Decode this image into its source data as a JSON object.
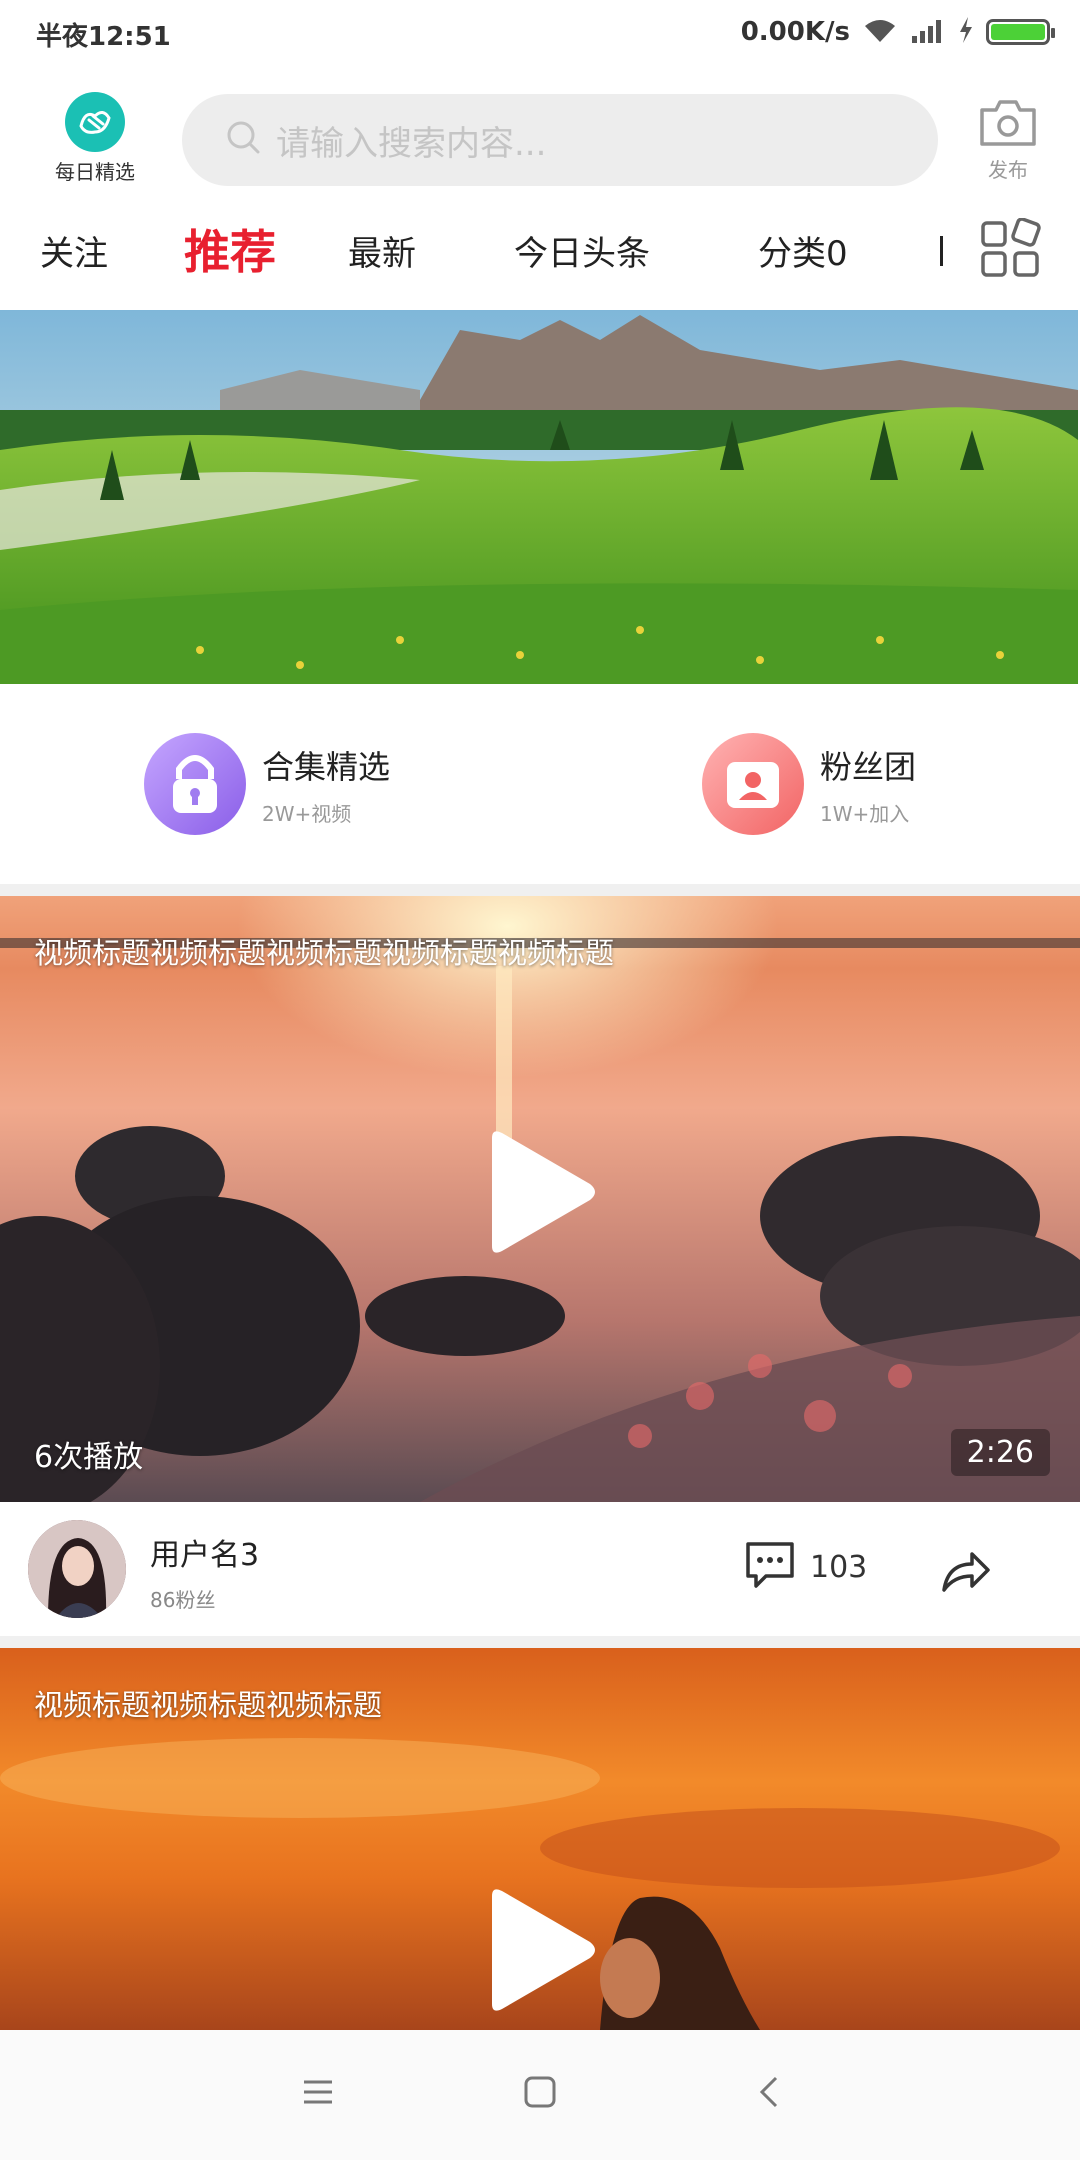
{
  "status_bar": {
    "time": "半夜12:51",
    "speed": "0.00K/s",
    "battery_color": "#4cd137"
  },
  "header": {
    "daily_label": "每日精选",
    "search_placeholder": "请输入搜索内容...",
    "publish_label": "发布"
  },
  "tabs": [
    {
      "label": "关注"
    },
    {
      "label": "推荐",
      "active": true
    },
    {
      "label": "最新"
    },
    {
      "label": "今日头条"
    },
    {
      "label": "分类0"
    }
  ],
  "quick_entries": [
    {
      "title": "合集精选",
      "subtitle": "2W+视频",
      "icon": "lock-icon"
    },
    {
      "title": "粉丝团",
      "subtitle": "1W+加入",
      "icon": "fan-group-icon"
    }
  ],
  "videos": [
    {
      "title": "视频标题视频标题视频标题视频标题视频标题",
      "plays": "6次播放",
      "duration": "2:26",
      "author": "用户名3",
      "fans": "86粉丝",
      "comments": "103"
    },
    {
      "title": "视频标题视频标题视频标题"
    }
  ],
  "colors": {
    "accent": "#e8202f",
    "teal": "#1bc0b4"
  }
}
